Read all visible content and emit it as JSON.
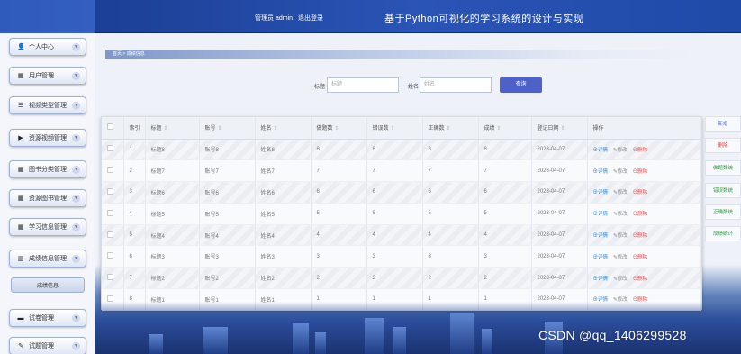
{
  "header": {
    "admin_label": "管理员 admin",
    "logout_label": "退出登录",
    "title": "基于Python可视化的学习系统的设计与实现"
  },
  "sidebar": {
    "items": [
      {
        "label": "个人中心",
        "icon": "user-icon"
      },
      {
        "label": "用户管理",
        "icon": "grid-icon"
      },
      {
        "label": "视频类型管理",
        "icon": "list-icon"
      },
      {
        "label": "资源视频管理",
        "icon": "video-icon"
      },
      {
        "label": "图书分类管理",
        "icon": "grid-icon"
      },
      {
        "label": "资源图书管理",
        "icon": "grid-icon"
      },
      {
        "label": "学习信息管理",
        "icon": "grid-icon"
      },
      {
        "label": "成绩信息管理",
        "icon": "table-icon"
      },
      {
        "label": "成绩信息",
        "icon": ""
      },
      {
        "label": "试卷管理",
        "icon": "doc-icon"
      },
      {
        "label": "试题管理",
        "icon": "edit-icon"
      }
    ]
  },
  "breadcrumb": "首页 > 成绩信息",
  "search": {
    "title_label": "标题",
    "title_placeholder": "标题",
    "name_label": "姓名",
    "name_placeholder": "姓名",
    "button_label": "查询"
  },
  "table": {
    "columns": [
      "",
      "索引",
      "标题",
      "账号",
      "姓名",
      "做题数",
      "错误数",
      "正确数",
      "成绩",
      "登记日期",
      "操作"
    ],
    "rows": [
      [
        "1",
        "标题8",
        "账号8",
        "姓名8",
        "8",
        "8",
        "8",
        "8",
        "2023-04-07"
      ],
      [
        "2",
        "标题7",
        "账号7",
        "姓名7",
        "7",
        "7",
        "7",
        "7",
        "2023-04-07"
      ],
      [
        "3",
        "标题6",
        "账号6",
        "姓名6",
        "6",
        "6",
        "6",
        "6",
        "2023-04-07"
      ],
      [
        "4",
        "标题5",
        "账号5",
        "姓名5",
        "5",
        "5",
        "5",
        "5",
        "2023-04-07"
      ],
      [
        "5",
        "标题4",
        "账号4",
        "姓名4",
        "4",
        "4",
        "4",
        "4",
        "2023-04-07"
      ],
      [
        "6",
        "标题3",
        "账号3",
        "姓名3",
        "3",
        "3",
        "3",
        "3",
        "2023-04-07"
      ],
      [
        "7",
        "标题2",
        "账号2",
        "姓名2",
        "2",
        "2",
        "2",
        "2",
        "2023-04-07"
      ],
      [
        "8",
        "标题1",
        "账号1",
        "姓名1",
        "1",
        "1",
        "1",
        "1",
        "2023-04-07"
      ]
    ],
    "actions": {
      "detail": "⊕详情",
      "edit": "✎修改",
      "delete": "⊖删除"
    }
  },
  "side_actions": [
    "新增",
    "删除",
    "做题数统",
    "错误数统",
    "正确数统",
    "成绩统计"
  ],
  "watermark": "CSDN @qq_1406299528",
  "colors": {
    "header": "#2a54b6",
    "search_button": "#4d61c9",
    "delete": "#e04b4b",
    "detail": "#2f86d6"
  }
}
